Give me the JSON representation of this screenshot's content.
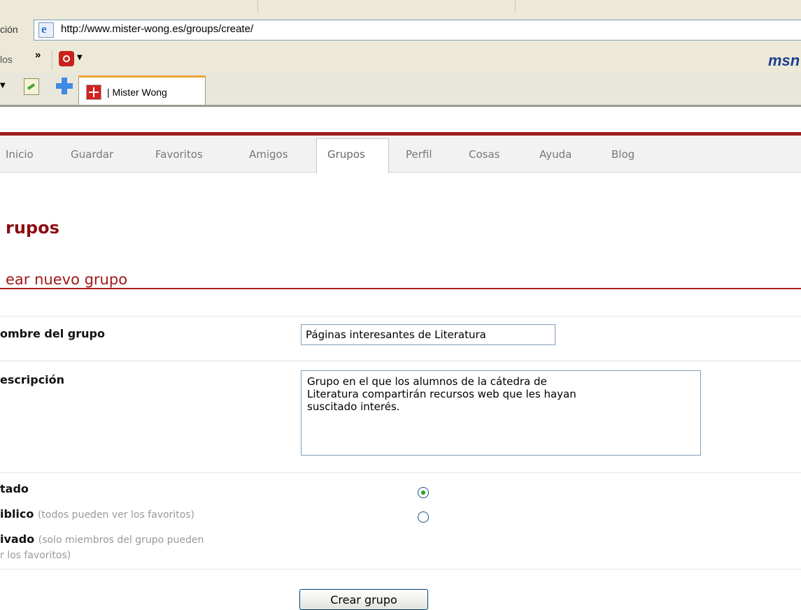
{
  "browser": {
    "address_label": "ción",
    "url": "http://www.mister-wong.es/groups/create/",
    "links_label": "los",
    "links_chevron": "»",
    "msn_logo": "msn",
    "tab_title": "| Mister Wong"
  },
  "nav": {
    "items": [
      "Inicio",
      "Guardar",
      "Favoritos",
      "Amigos",
      "Grupos",
      "Perfil",
      "Cosas",
      "Ayuda",
      "Blog"
    ],
    "active": "Grupos"
  },
  "page": {
    "title": "rupos",
    "section_title": "ear nuevo grupo"
  },
  "form": {
    "name_label": "ombre del grupo",
    "name_value": "Páginas interesantes de Literatura",
    "description_label": "escripción",
    "description_value": "Grupo en el que los alumnos de la cátedra de\nLiteratura compartirán recursos web que les hayan\nsuscitado interés.",
    "status_label": "tado",
    "public_label": "iblico",
    "public_note": "(todos pueden ver los favoritos)",
    "private_label": "ivado",
    "private_note_line1": "(solo miembros del grupo pueden",
    "private_note_line2": "r los favoritos)",
    "selected_option": "public",
    "submit_label": "Crear grupo"
  },
  "colors": {
    "brand_red": "#9d1c1c",
    "title_red": "#8b0f12",
    "radio_selected": "#21a121"
  }
}
